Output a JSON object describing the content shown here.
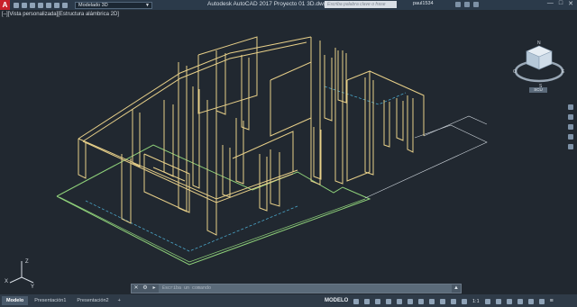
{
  "title_bar": {
    "app_logo": "A",
    "workspace": "Modelado 3D",
    "window_title": "Autodesk AutoCAD 2017   Proyecto 01 3D.dwg",
    "search_placeholder": "Escriba palabra clave o frase",
    "user": "paul1534",
    "controls": [
      "—",
      "□",
      "✕"
    ]
  },
  "viewport": {
    "label": "[–][Vista personalizada][Estructura alámbrica 2D]",
    "viewcube": {
      "wcs_label": "SCU",
      "compass": {
        "north": "N",
        "south": "S",
        "east": "E",
        "west": "O"
      }
    },
    "ucs": {
      "x": "X",
      "y": "Y",
      "z": "Z"
    }
  },
  "command_line": {
    "close": "✕",
    "placeholder": "Escriba un comando"
  },
  "status_bar": {
    "tabs": [
      {
        "label": "Modelo",
        "active": true
      },
      {
        "label": "Presentación1",
        "active": false
      },
      {
        "label": "Presentación2",
        "active": false
      }
    ],
    "add_tab": "+",
    "model_label": "MODELO",
    "scale": "1:1",
    "menu": "≡"
  },
  "colors": {
    "background": "#212830",
    "walls": "#e8d089",
    "floor": "#8fd17a",
    "guides": "#4aa6c9"
  }
}
